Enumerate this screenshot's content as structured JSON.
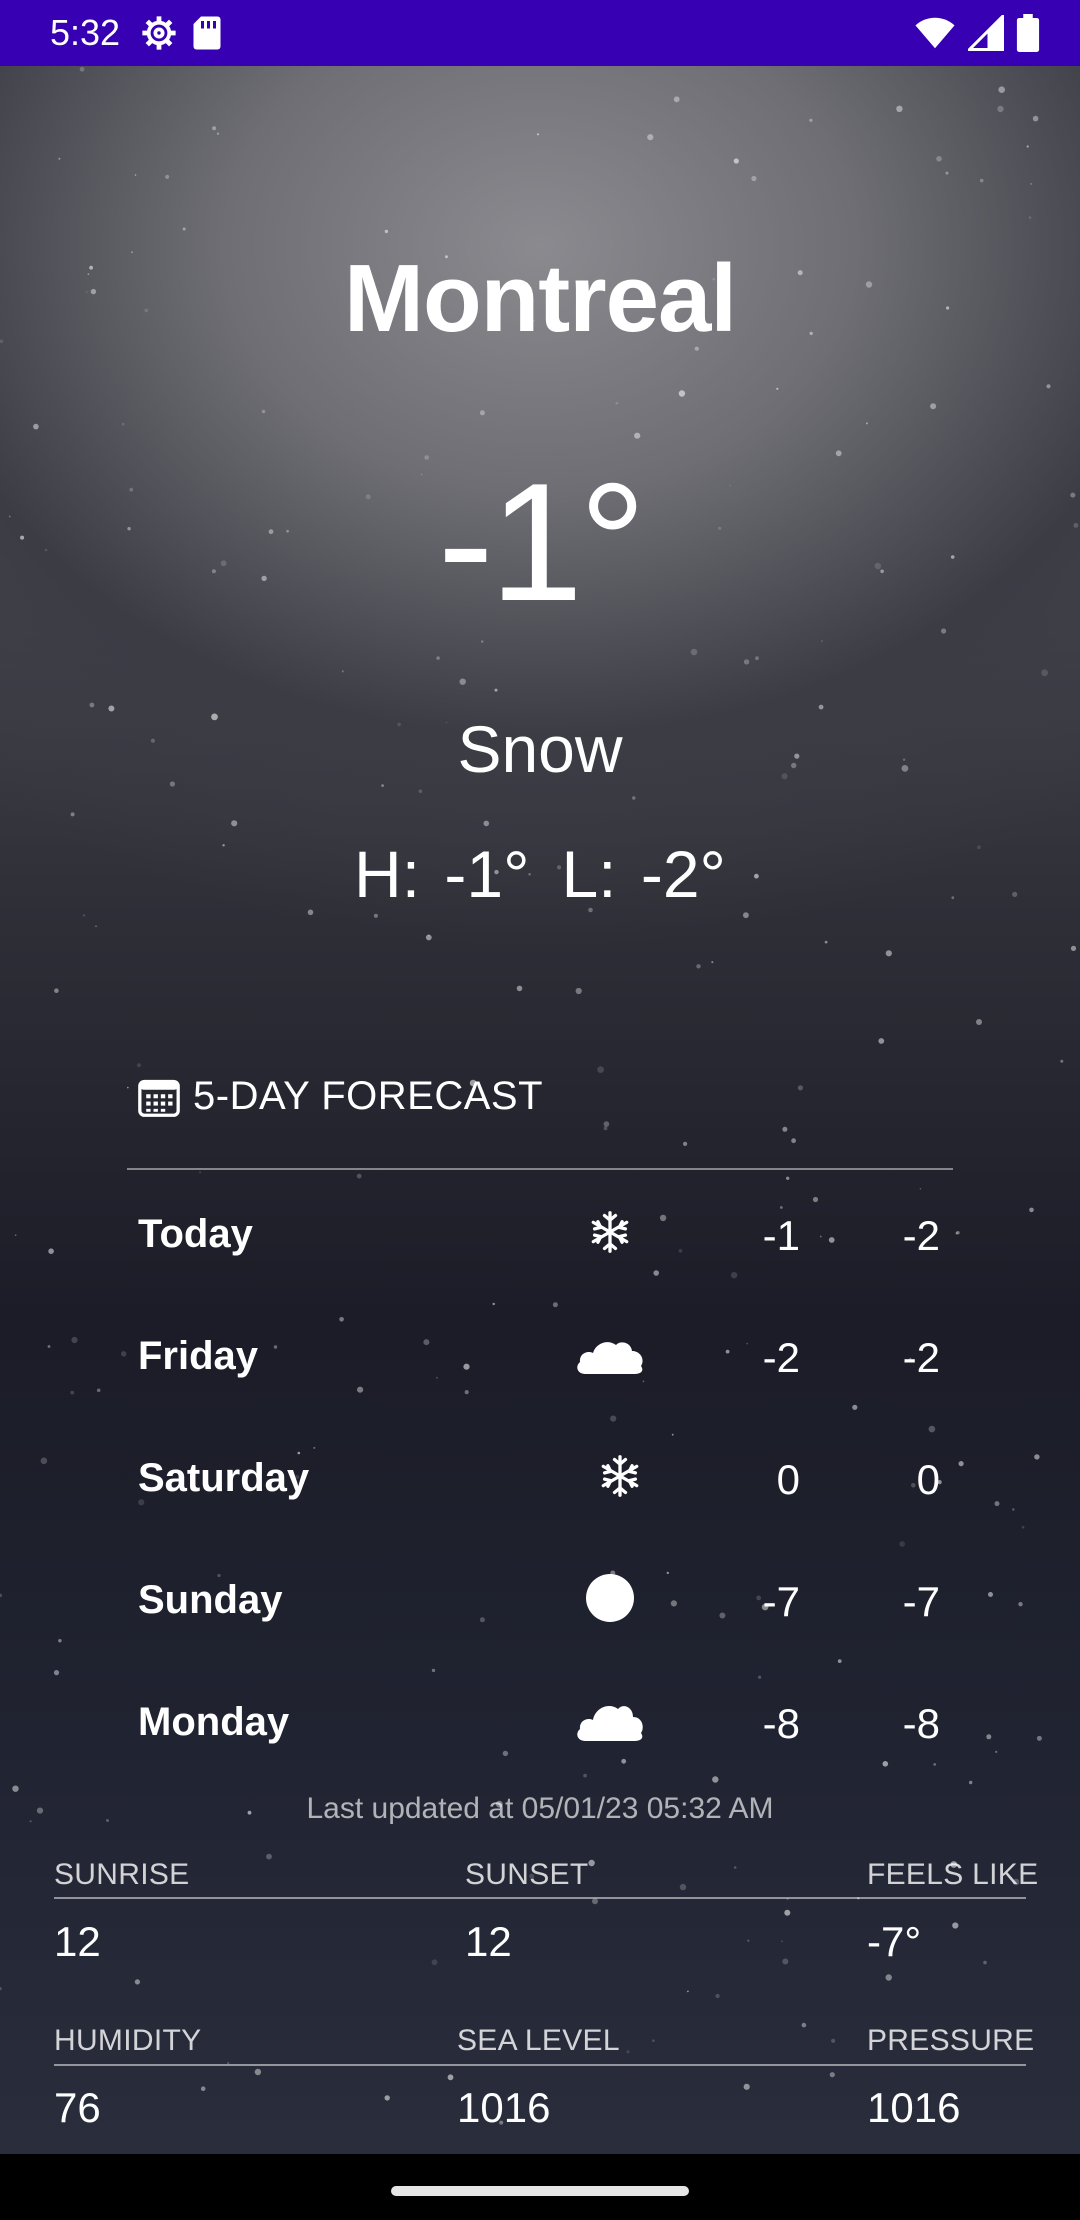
{
  "status_bar": {
    "time": "5:32",
    "left_icons": [
      "settings-gear-icon",
      "sd-card-icon"
    ],
    "right_icons": [
      "wifi-icon",
      "cellular-signal-icon",
      "battery-icon"
    ],
    "background": "#3700b3"
  },
  "weather": {
    "city": "Montreal",
    "temperature": "-1°",
    "condition": "Snow",
    "high": "H: -1°",
    "low": "L: -2°"
  },
  "forecast": {
    "header_icon": "calendar-icon",
    "title": "5-DAY FORECAST",
    "days": [
      {
        "day": "Today",
        "icon": "snowflake-icon",
        "high": "-1",
        "low": "-2"
      },
      {
        "day": "Friday",
        "icon": "cloud-icon",
        "high": "-2",
        "low": "-2"
      },
      {
        "day": "Saturday",
        "icon": "snowflake-icon",
        "high": "0",
        "low": "0"
      },
      {
        "day": "Sunday",
        "icon": "sun-icon",
        "high": "-7",
        "low": "-7"
      },
      {
        "day": "Monday",
        "icon": "cloud-icon",
        "high": "-8",
        "low": "-8"
      }
    ],
    "last_updated": "Last updated at 05/01/23 05:32 AM"
  },
  "details": {
    "sunrise": {
      "label": "SUNRISE",
      "value": "12"
    },
    "sunset": {
      "label": "SUNSET",
      "value": "12"
    },
    "feels_like": {
      "label": "FEELS LIKE",
      "value": "-7°"
    },
    "humidity": {
      "label": "HUMIDITY",
      "value": "76"
    },
    "sea_level": {
      "label": "SEA LEVEL",
      "value": "1016"
    },
    "pressure": {
      "label": "PRESSURE",
      "value": "1016"
    }
  }
}
